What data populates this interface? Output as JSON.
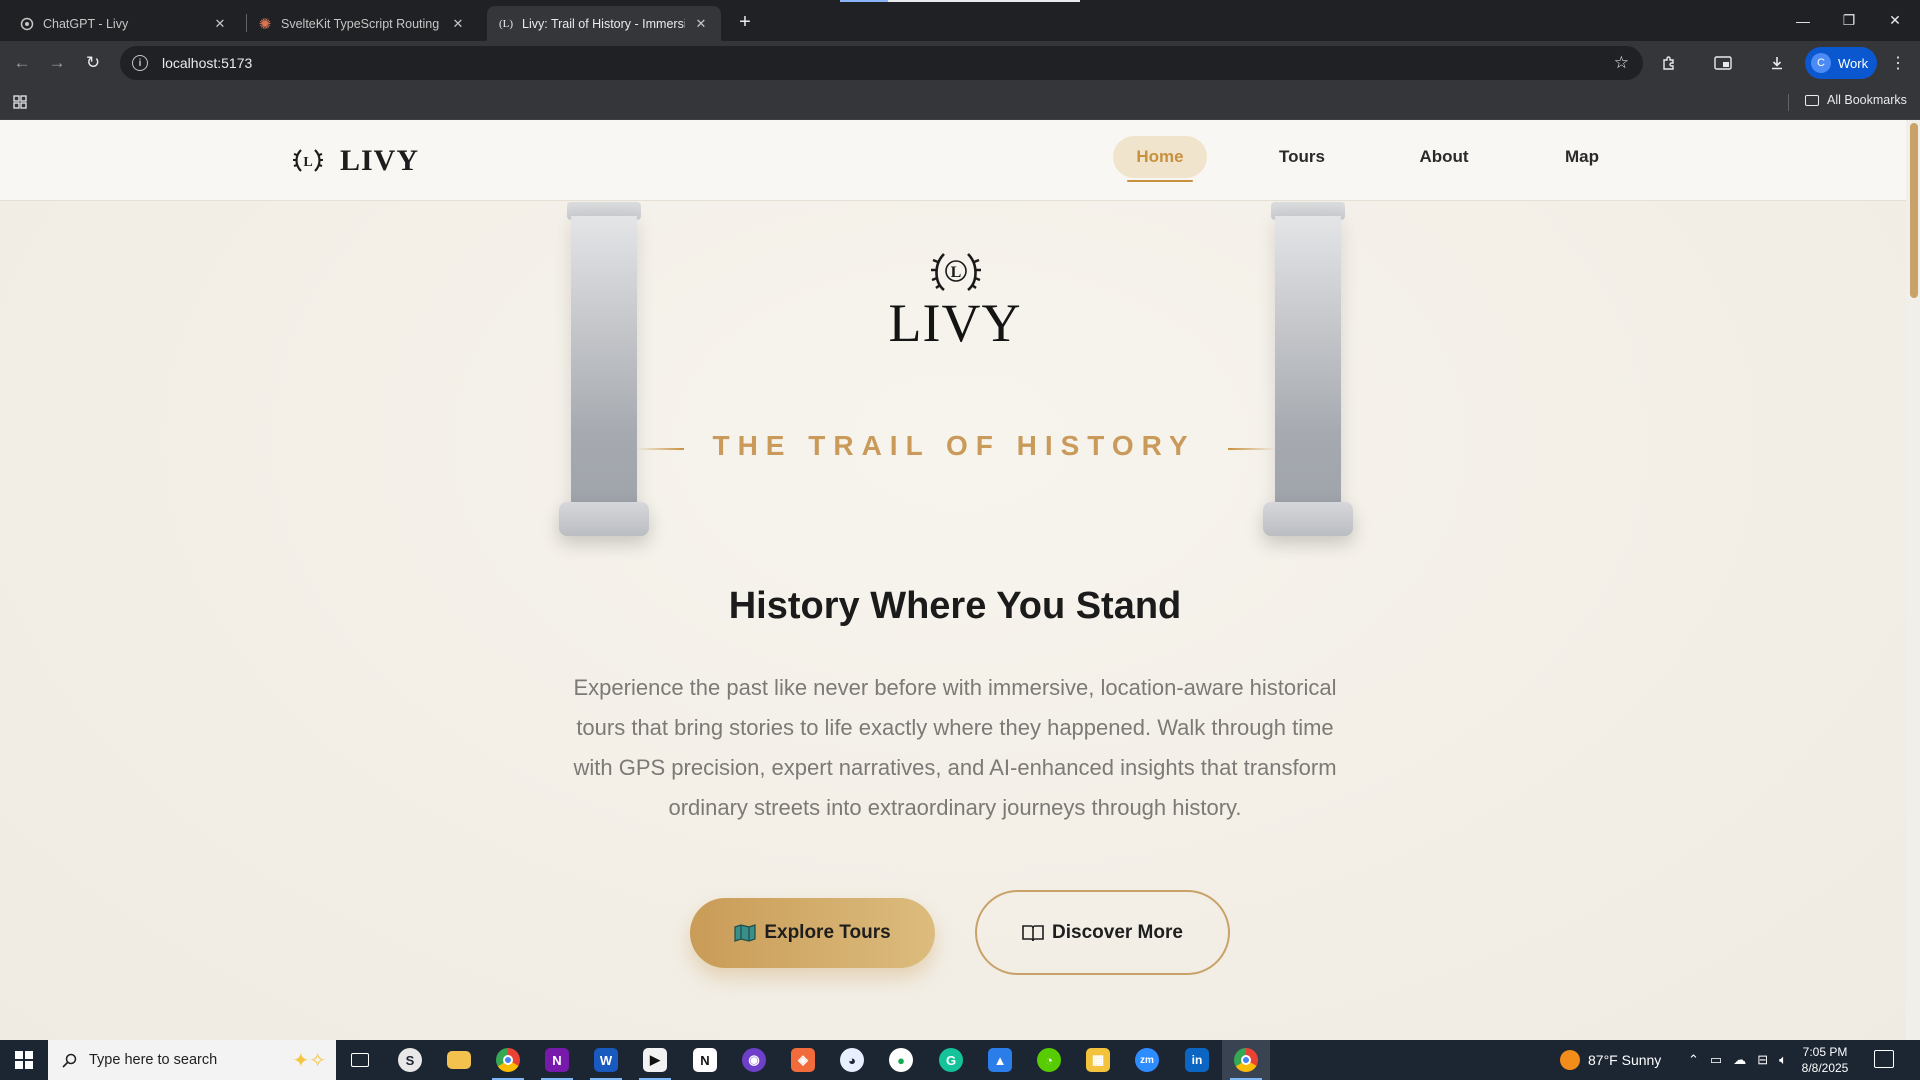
{
  "browser": {
    "tabs": [
      {
        "title": "ChatGPT - Livy",
        "icon": "openai-icon"
      },
      {
        "title": "SvelteKit TypeScript Routing Err",
        "icon": "claude-icon"
      },
      {
        "title": "Livy: Trail of History - Immersive",
        "icon": "livy-favicon-icon"
      }
    ],
    "url": "localhost:5173",
    "profile_initial": "C",
    "profile_name": "Work",
    "all_bookmarks": "All Bookmarks"
  },
  "site": {
    "brand": "LIVY",
    "nav": [
      {
        "label": "Home",
        "active": true
      },
      {
        "label": "Tours",
        "active": false
      },
      {
        "label": "About",
        "active": false
      },
      {
        "label": "Map",
        "active": false
      }
    ],
    "hero": {
      "logo_text": "LIVY",
      "emblem_letter": "L",
      "tagline": "THE TRAIL OF HISTORY",
      "headline": "History Where You Stand",
      "lede": "Experience the past like never before with immersive, location-aware historical tours that bring stories to life exactly where they happened. Walk through time with GPS precision, expert narratives, and AI-enhanced insights that transform ordinary streets into extraordinary journeys through history.",
      "primary_button": "Explore Tours",
      "secondary_button": "Discover More"
    },
    "colors": {
      "accent": "#c7913f",
      "primary_btn_start": "#c99c57",
      "primary_btn_end": "#dcbc7e",
      "text_dark": "#1b1b1b",
      "text_muted": "#7c7a76"
    }
  },
  "taskbar": {
    "search_placeholder": "Type here to search",
    "weather": "87°F  Sunny",
    "time": "7:05 PM",
    "date": "8/8/2025"
  }
}
